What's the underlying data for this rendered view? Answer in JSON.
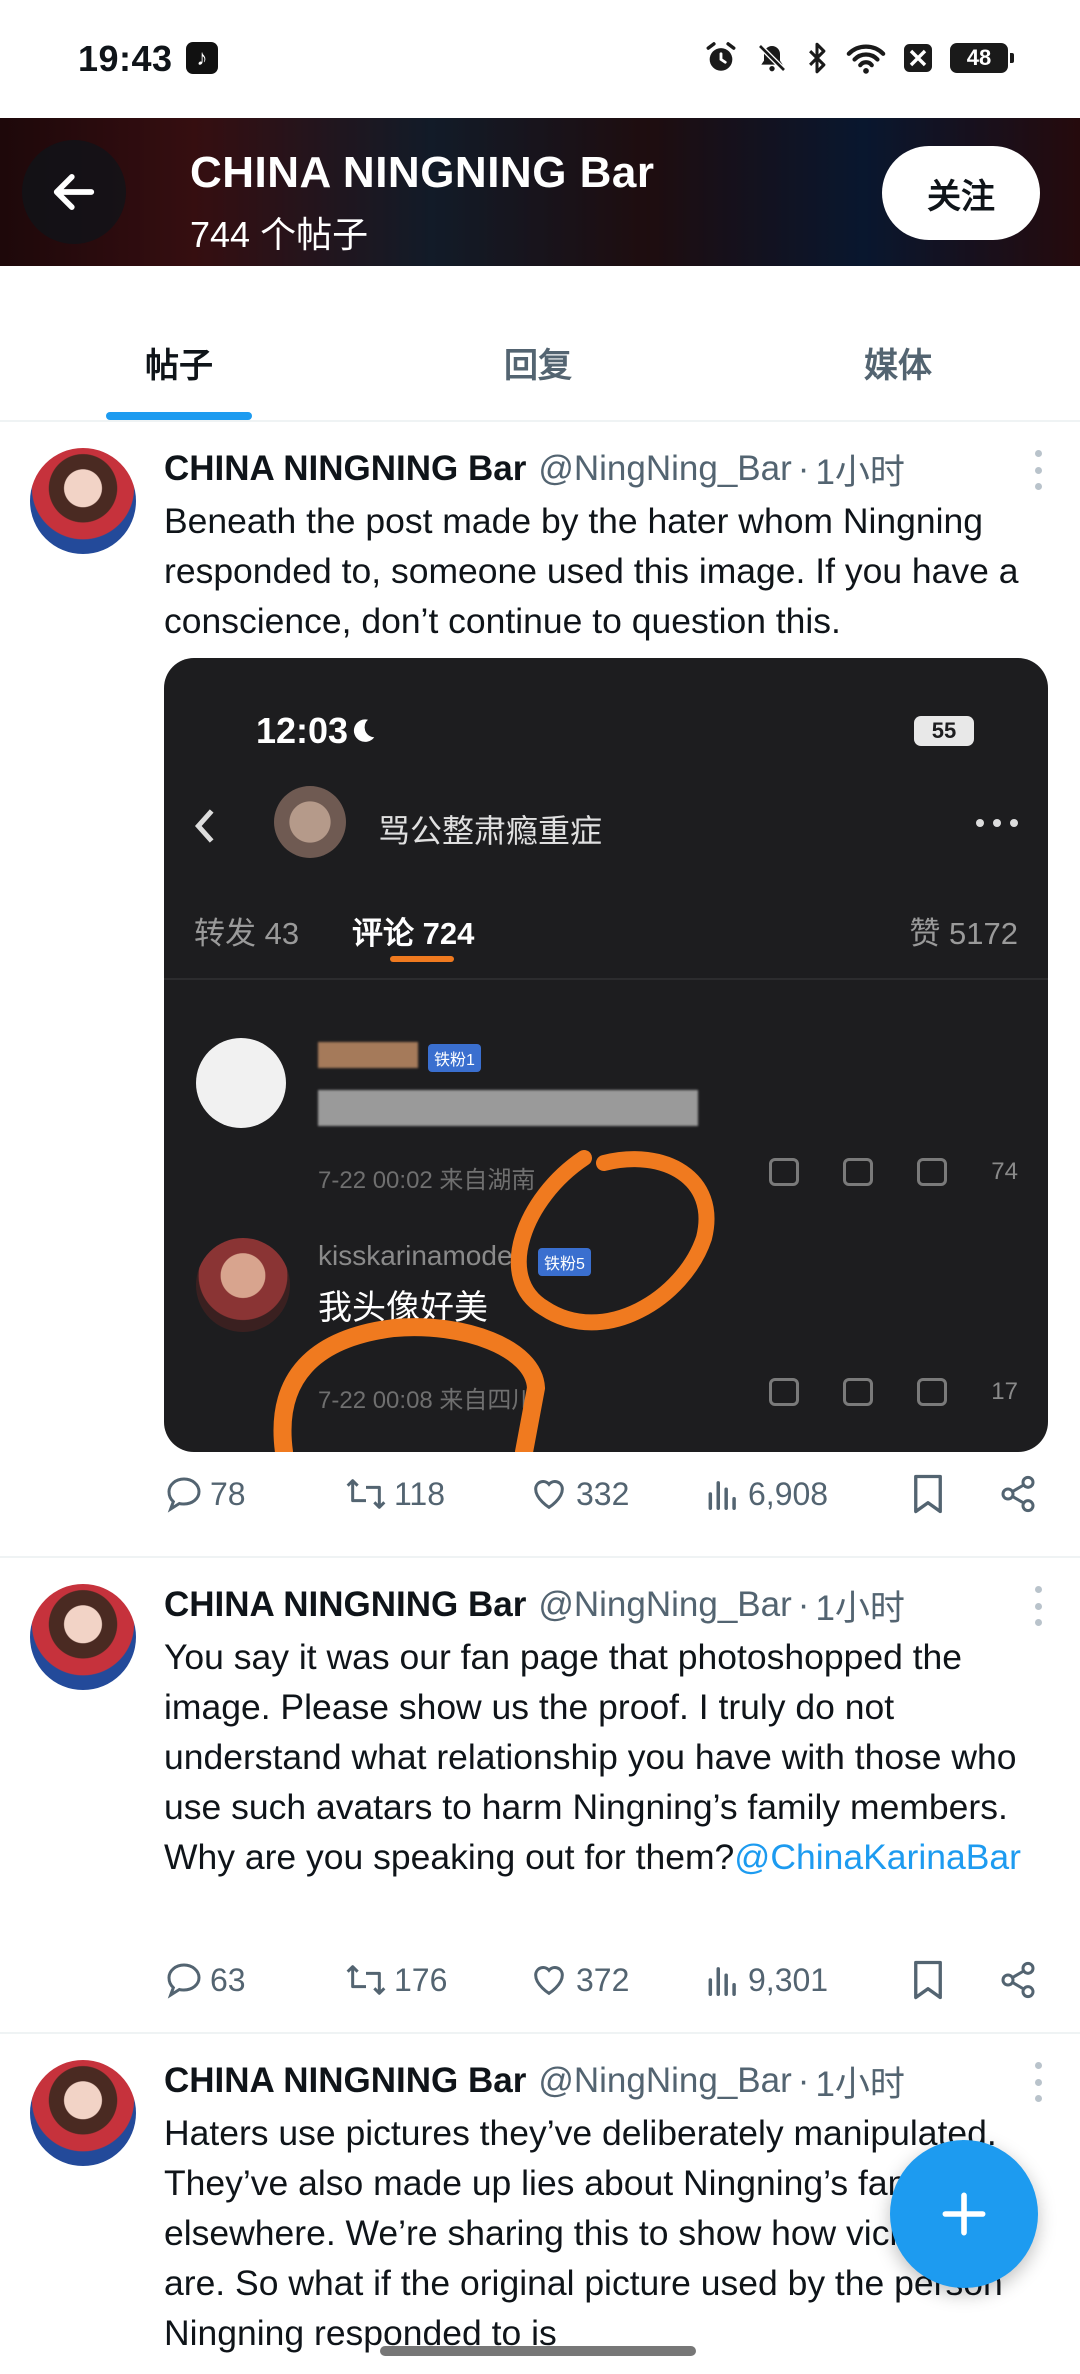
{
  "status_bar": {
    "time": "19:43",
    "app_icon": "tiktok-icon",
    "battery": "48",
    "icons": [
      "alarm-icon",
      "mute-icon",
      "bluetooth-icon",
      "wifi-icon",
      "x-app-icon",
      "battery-icon"
    ]
  },
  "header": {
    "title": "CHINA NINGNING Bar",
    "subtitle": "744 个帖子",
    "follow_label": "关注",
    "back_icon": "back-arrow-icon"
  },
  "tabs": [
    {
      "label": "帖子",
      "active": true
    },
    {
      "label": "回复",
      "active": false
    },
    {
      "label": "媒体",
      "active": false
    }
  ],
  "posts": [
    {
      "name": "CHINA NINGNING Bar",
      "handle": "@NingNing_Bar",
      "dot": "·",
      "time": "1小时",
      "text": "Beneath the post made by the hater whom Ningning responded to, someone used this image. If you have a conscience, don’t continue to question this.",
      "media": {
        "time": "12:03",
        "battery": "55",
        "username": "骂公整肃瘾重症",
        "tab_repost": "转发 43",
        "tab_comments": "评论 724",
        "tab_likes": "赞 5172",
        "comment1_badge": "铁粉1",
        "comment1_meta": "7-22 00:02 来自湖南",
        "comment1_likes": "74",
        "comment2_name": "kisskarinamode",
        "comment2_badge": "铁粉5",
        "comment2_text": "我头像好美",
        "comment2_meta": "7-22 00:08 来自四川",
        "comment2_likes": "17"
      },
      "stats": {
        "replies": "78",
        "reposts": "118",
        "likes": "332",
        "views": "6,908"
      }
    },
    {
      "name": "CHINA NINGNING Bar",
      "handle": "@NingNing_Bar",
      "dot": "·",
      "time": "1小时",
      "text": "You say it was our fan page that photoshopped the image. Please show us the proof. I truly do not understand what relationship you have with those who use such avatars to harm Ningning’s family members. Why are you speaking out for them?",
      "mention": "@ChinaKarinaBar",
      "stats": {
        "replies": "63",
        "reposts": "176",
        "likes": "372",
        "views": "9,301"
      }
    },
    {
      "name": "CHINA NINGNING Bar",
      "handle": "@NingNing_Bar",
      "dot": "·",
      "time": "1小时",
      "text": "Haters use pictures they’ve deliberately manipulated. They’ve also made up lies about Ningning’s family elsewhere. We’re sharing this to show how vicious they are. So what if the original picture used by the person Ningning responded to is"
    }
  ],
  "fab": {
    "icon": "plus-icon"
  }
}
